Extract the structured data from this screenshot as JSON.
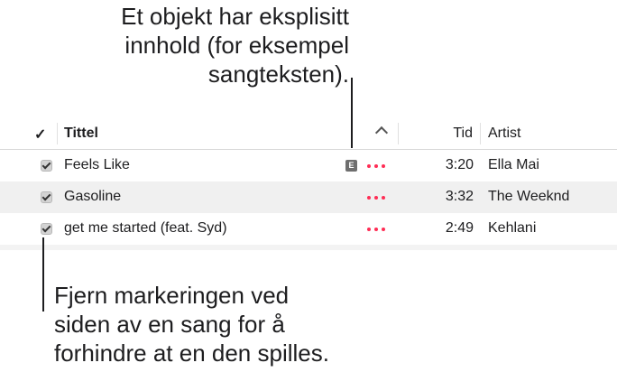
{
  "callouts": {
    "explicit_note": [
      "Et objekt har eksplisitt",
      "innhold (for eksempel",
      "sangteksten)."
    ],
    "uncheck_note": [
      "Fjern markeringen ved",
      "siden av en sang for å",
      "forhindre at en den spilles."
    ]
  },
  "header": {
    "check_label": "✓",
    "title_label": "Tittel",
    "time_label": "Tid",
    "artist_label": "Artist"
  },
  "explicit_badge": "E",
  "songs": [
    {
      "title": "Feels Like",
      "explicit": true,
      "time": "3:20",
      "artist": "Ella Mai",
      "checked": true
    },
    {
      "title": "Gasoline",
      "explicit": false,
      "time": "3:32",
      "artist": "The Weeknd",
      "checked": true
    },
    {
      "title": "get me started (feat. Syd)",
      "explicit": false,
      "time": "2:49",
      "artist": "Kehlani",
      "checked": true
    }
  ],
  "colors": {
    "accent": "#ff2d55",
    "alt_row": "#f0f0f0"
  }
}
